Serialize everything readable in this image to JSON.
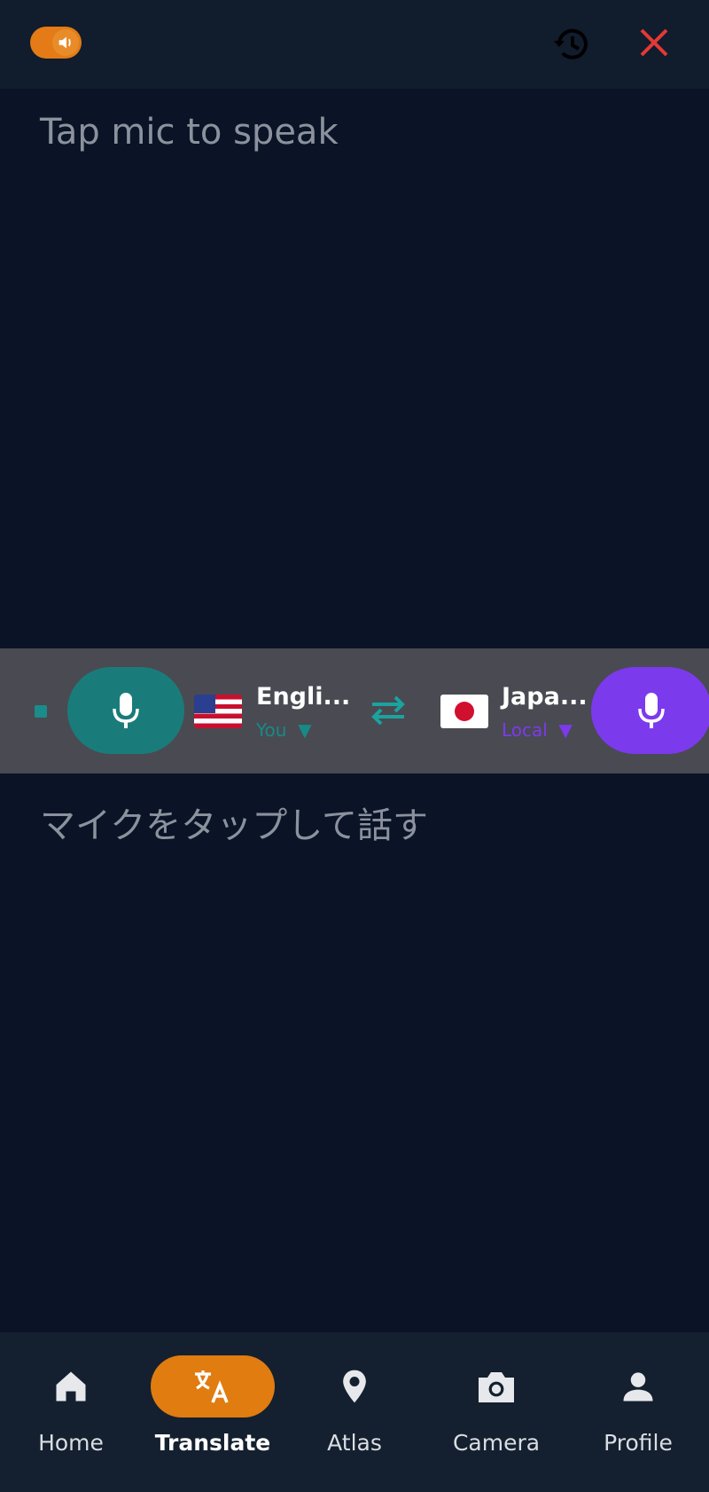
{
  "header": {
    "sound_toggle_state": "on",
    "icons": [
      "speaker-icon",
      "history-icon",
      "close-icon"
    ],
    "colors": {
      "toggle": "#e47b16",
      "close": "#e53935"
    }
  },
  "source": {
    "placeholder": "Tap mic to speak"
  },
  "target": {
    "placeholder": "マイクをタップして話す"
  },
  "language_bar": {
    "left_language": {
      "name": "Engli...",
      "role": "You",
      "flag": "us-flag",
      "color": "#178a86"
    },
    "right_language": {
      "name": "Japa...",
      "role": "Local",
      "flag": "jp-flag",
      "color": "#7c3aed"
    },
    "swap_icon": "swap-icon"
  },
  "nav": {
    "items": [
      {
        "label": "Home",
        "icon": "home-icon"
      },
      {
        "label": "Translate",
        "icon": "translate-icon",
        "active": true
      },
      {
        "label": "Atlas",
        "icon": "location-pin-icon"
      },
      {
        "label": "Camera",
        "icon": "camera-icon"
      },
      {
        "label": "Profile",
        "icon": "profile-icon"
      }
    ]
  }
}
